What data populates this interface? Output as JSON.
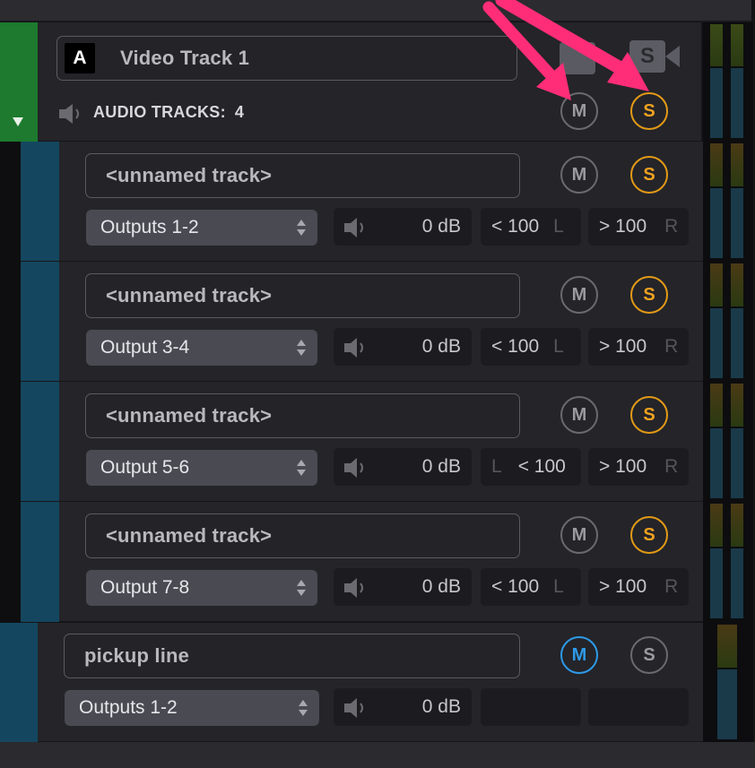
{
  "video_track": {
    "badge": "A",
    "name": "Video Track 1",
    "audio_tracks_label": "AUDIO TRACKS:",
    "audio_tracks_count": "4",
    "mute_label": "M",
    "solo_label": "S",
    "ghost_solo_label": "S"
  },
  "sub_tracks": [
    {
      "name": "<unnamed track>",
      "output": "Outputs 1-2",
      "volume": "0 dB",
      "pan_left": "< 100",
      "pan_left_ch": "L",
      "pan_right": "> 100",
      "pan_right_ch": "R"
    },
    {
      "name": "<unnamed track>",
      "output": "Output 3-4",
      "volume": "0 dB",
      "pan_left": "< 100",
      "pan_left_ch": "L",
      "pan_right": "> 100",
      "pan_right_ch": "R"
    },
    {
      "name": "<unnamed track>",
      "output": "Output 5-6",
      "volume": "0 dB",
      "pan_left": "< 100",
      "pan_left_ch": "L",
      "pan_right": "> 100",
      "pan_right_ch": "R"
    },
    {
      "name": "<unnamed track>",
      "output": "Output 7-8",
      "volume": "0 dB",
      "pan_left": "< 100",
      "pan_left_ch": "L",
      "pan_right": "> 100",
      "pan_right_ch": "R"
    }
  ],
  "buttons": {
    "mute": "M",
    "solo": "S"
  },
  "pickup_track": {
    "name": "pickup line",
    "output": "Outputs 1-2",
    "volume": "0 dB",
    "mute_label": "M",
    "solo_label": "S"
  },
  "colors": {
    "solo_accent": "#e39a16",
    "mute_active": "#2e9ae8",
    "arrow": "#ff2d78",
    "video_strip": "#1d7a2e",
    "audio_strip": "#14475f"
  }
}
